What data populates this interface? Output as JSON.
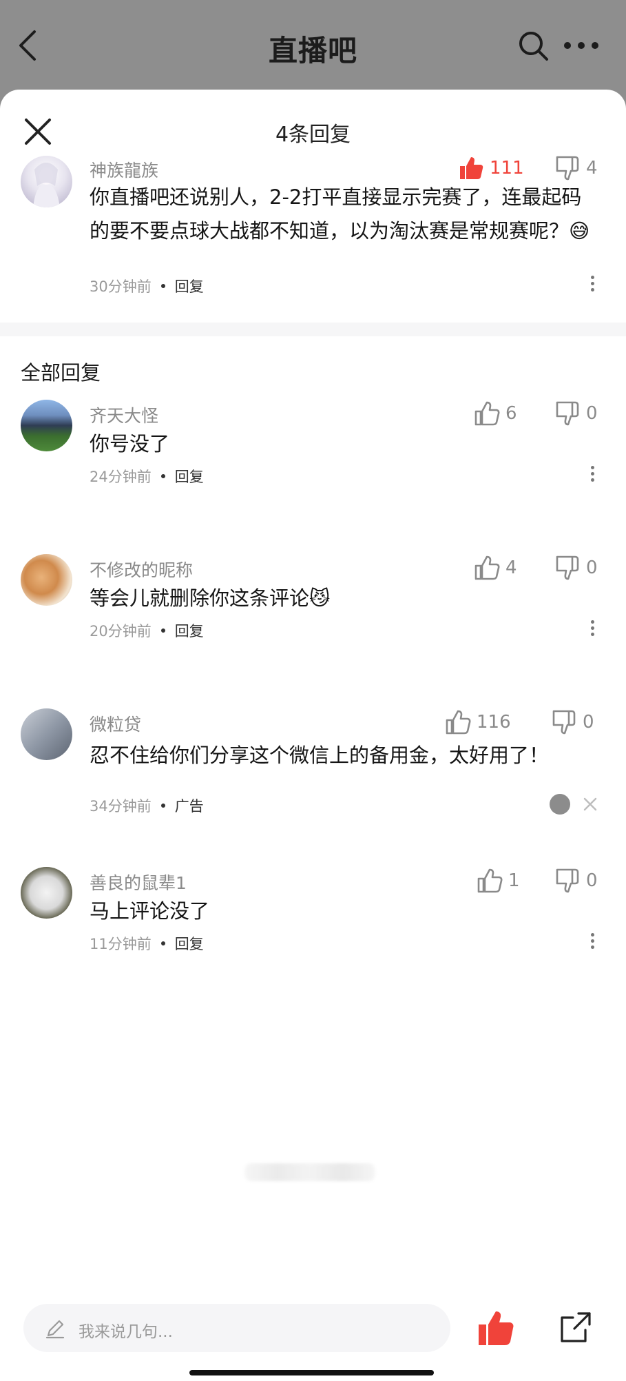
{
  "nav": {
    "title": "直播吧"
  },
  "sheet": {
    "title": "4条回复"
  },
  "main_comment": {
    "username": "神族龍族",
    "text": "你直播吧还说别人，2-2打平直接显示完赛了，连最起码的要不要点球大战都不知道，以为淘汰赛是常规赛呢？😅",
    "likes": "111",
    "dislikes": "4",
    "time": "30分钟前",
    "reply_label": "回复"
  },
  "section": {
    "title": "全部回复"
  },
  "replies": [
    {
      "username": "齐天大怪",
      "text": "你号没了",
      "likes": "6",
      "dislikes": "0",
      "time": "24分钟前",
      "action": "回复"
    },
    {
      "username": "不修改的昵称",
      "text": "等会儿就删除你这条评论😼",
      "likes": "4",
      "dislikes": "0",
      "time": "20分钟前",
      "action": "回复"
    },
    {
      "username": "微粒贷",
      "text": "忍不住给你们分享这个微信上的备用金，太好用了！",
      "likes": "116",
      "dislikes": "0",
      "time": "34分钟前",
      "action": "广告"
    },
    {
      "username": "善良的鼠辈1",
      "text": "马上评论没了",
      "likes": "1",
      "dislikes": "0",
      "time": "11分钟前",
      "action": "回复"
    }
  ],
  "composer": {
    "placeholder": "我来说几句..."
  },
  "colors": {
    "accent_red": "#f0433a",
    "overlay_gray": "#8e8e8e"
  }
}
